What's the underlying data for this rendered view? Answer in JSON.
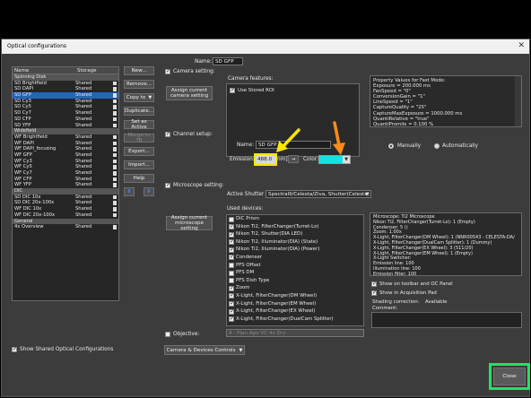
{
  "window": {
    "title": "Optical configurations",
    "close_glyph": "✕"
  },
  "list": {
    "col_name": "Name",
    "col_storage": "Storage",
    "rows": [
      {
        "type": "group",
        "name": "Spinning Disk"
      },
      {
        "type": "item",
        "name": "SD Brightfield",
        "storage": "Shared"
      },
      {
        "type": "item",
        "name": "SD DAPI",
        "storage": "Shared"
      },
      {
        "type": "item",
        "name": "SD GFP",
        "storage": "Shared",
        "selected": true
      },
      {
        "type": "item",
        "name": "SD Cy3",
        "storage": "Shared"
      },
      {
        "type": "item",
        "name": "SD Cy5",
        "storage": "Shared"
      },
      {
        "type": "item",
        "name": "SD Cy7",
        "storage": "Shared"
      },
      {
        "type": "item",
        "name": "SD CFP",
        "storage": "Shared"
      },
      {
        "type": "item",
        "name": "SD YFP",
        "storage": "Shared"
      },
      {
        "type": "group",
        "name": "Widefield"
      },
      {
        "type": "item",
        "name": "WF Brightfield",
        "storage": "Shared"
      },
      {
        "type": "item",
        "name": "WF DAPI",
        "storage": "Shared"
      },
      {
        "type": "item",
        "name": "WF DAPI_focusing",
        "storage": "Shared"
      },
      {
        "type": "item",
        "name": "WF GFP",
        "storage": "Shared"
      },
      {
        "type": "item",
        "name": "WF Cy3",
        "storage": "Shared"
      },
      {
        "type": "item",
        "name": "WF Cy5",
        "storage": "Shared"
      },
      {
        "type": "item",
        "name": "WF Cy7",
        "storage": "Shared"
      },
      {
        "type": "item",
        "name": "WF CFP",
        "storage": "Shared"
      },
      {
        "type": "item",
        "name": "WF YFP",
        "storage": "Shared"
      },
      {
        "type": "group",
        "name": "DIC"
      },
      {
        "type": "item",
        "name": "SD DIC 10x",
        "storage": "Shared"
      },
      {
        "type": "item",
        "name": "SD DIC 20x-100x",
        "storage": "Shared"
      },
      {
        "type": "item",
        "name": "WF DIC 10x",
        "storage": "Shared"
      },
      {
        "type": "item",
        "name": "WF DIC 20x-100x",
        "storage": "Shared"
      },
      {
        "type": "group",
        "name": "General"
      },
      {
        "type": "item",
        "name": "4x Overview",
        "storage": "Shared"
      }
    ]
  },
  "side_buttons": {
    "new": "New...",
    "remove": "Remove...",
    "copy_to": "Copy to",
    "duplicate": "Duplicate...",
    "set_active": "Set as Active",
    "merge_to_tb": "Merge to TB",
    "export": "Export...",
    "import": "Import...",
    "help": "Help"
  },
  "name_label": "Name:",
  "name_value": "SD GFP",
  "camera": {
    "checkbox_label": "Camera setting:",
    "assign_btn": "Assign current camera setting",
    "features_label": "Camera features:",
    "use_stored_roi": "Use Stored ROI",
    "properties": "Property Values for Fast Mode:\nExposure = 200.000 ms\nFanSpeed = \"0\"\nConversionGain = \"1\"\nLineSpeed = \"1\"\nCaptureQuality = \"25\"\nCaptureMaxExposure = 1000.000 ms\nQuantiRelative = \"true\"\nQuantiPromile = 0.100 %"
  },
  "channel": {
    "checkbox_label": "Channel setup:",
    "name_label": "Name:",
    "name_value": "SD GFP",
    "emission_label": "Emission:",
    "emission_value": "488.0",
    "emission_unit": "nm]",
    "arrow_btn": "→",
    "color_label": "Color:",
    "color_value": "#16e0e6",
    "manually": "Manually",
    "automatically": "Automatically"
  },
  "microscope": {
    "checkbox_label": "Microscope setting:",
    "active_shutter_label": "Active Shutter :",
    "active_shutter_value": "SpectraIII/Celesta/Ziva, Shutter(Celesta)",
    "assign_btn": "Assign current microscope setting",
    "used_devices_label": "Used devices:",
    "devices": [
      {
        "label": "DIC Prism",
        "checked": false
      },
      {
        "label": "Nikon Ti2, FilterChanger(Turret-Lo)",
        "checked": true
      },
      {
        "label": "Nikon Ti2, Shutter(DIA LED)",
        "checked": true
      },
      {
        "label": "Nikon Ti2, Illuminator(DIA) (State)",
        "checked": true
      },
      {
        "label": "Nikon Ti2, Illuminator(DIA) (Power)",
        "checked": true
      },
      {
        "label": "Condenser",
        "checked": true
      },
      {
        "label": "PFS Offset",
        "checked": false
      },
      {
        "label": "PFS DM",
        "checked": false
      },
      {
        "label": "PFS Dish Type",
        "checked": false
      },
      {
        "label": "Zoom",
        "checked": true
      },
      {
        "label": "X-Light, FilterChanger(DM Wheel)",
        "checked": true
      },
      {
        "label": "X-Light, FilterChanger(EM Wheel)",
        "checked": true
      },
      {
        "label": "X-Light, FilterChanger(EX Wheel)",
        "checked": true
      },
      {
        "label": "X-Light, FilterChanger(DualCam Splitter)",
        "checked": true
      }
    ],
    "summary": "Microscope: Ti2 Microscope\nNikon Ti2, FilterChanger(Turret-Lo): 1 (Empty)\nCondenser: 5 ()\nZoom: 1.00x\nX-Light, FilterChanger(DM Wheel): 1 (NNR00543 - CELESTA-DA/\nX-Light, FilterChanger(DualCam Splitter): 1 (Dummy)\nX-Light, FilterChanger(EX Wheel): 3 (511/20)\nX-Light, FilterChanger(EM Wheel): 1 (Empty)\nX-Light Switcher:\nEmission line: 100\nIllumination line: 100\nEmission filter: 100",
    "show_toolbar": "Show on toolbar and OC Panel",
    "show_acq_pad": "Show in Acquisition Pad",
    "shading_label": "Shading correction:",
    "shading_value": "Available",
    "comment_label": "Comment:"
  },
  "objective": {
    "checkbox_label": "Objective:",
    "value": "4 - Plan Apo VC 4x Dry"
  },
  "bottom": {
    "show_shared": "Show Shared Optical Configurations",
    "camera_devices": "Camera & Devices Controls",
    "close": "Close"
  },
  "colors": {
    "selection": "#1f66c1",
    "annotation_yellow": "#ffe600",
    "annotation_orange": "#ff8c1a",
    "annotation_green": "#22e06a"
  }
}
